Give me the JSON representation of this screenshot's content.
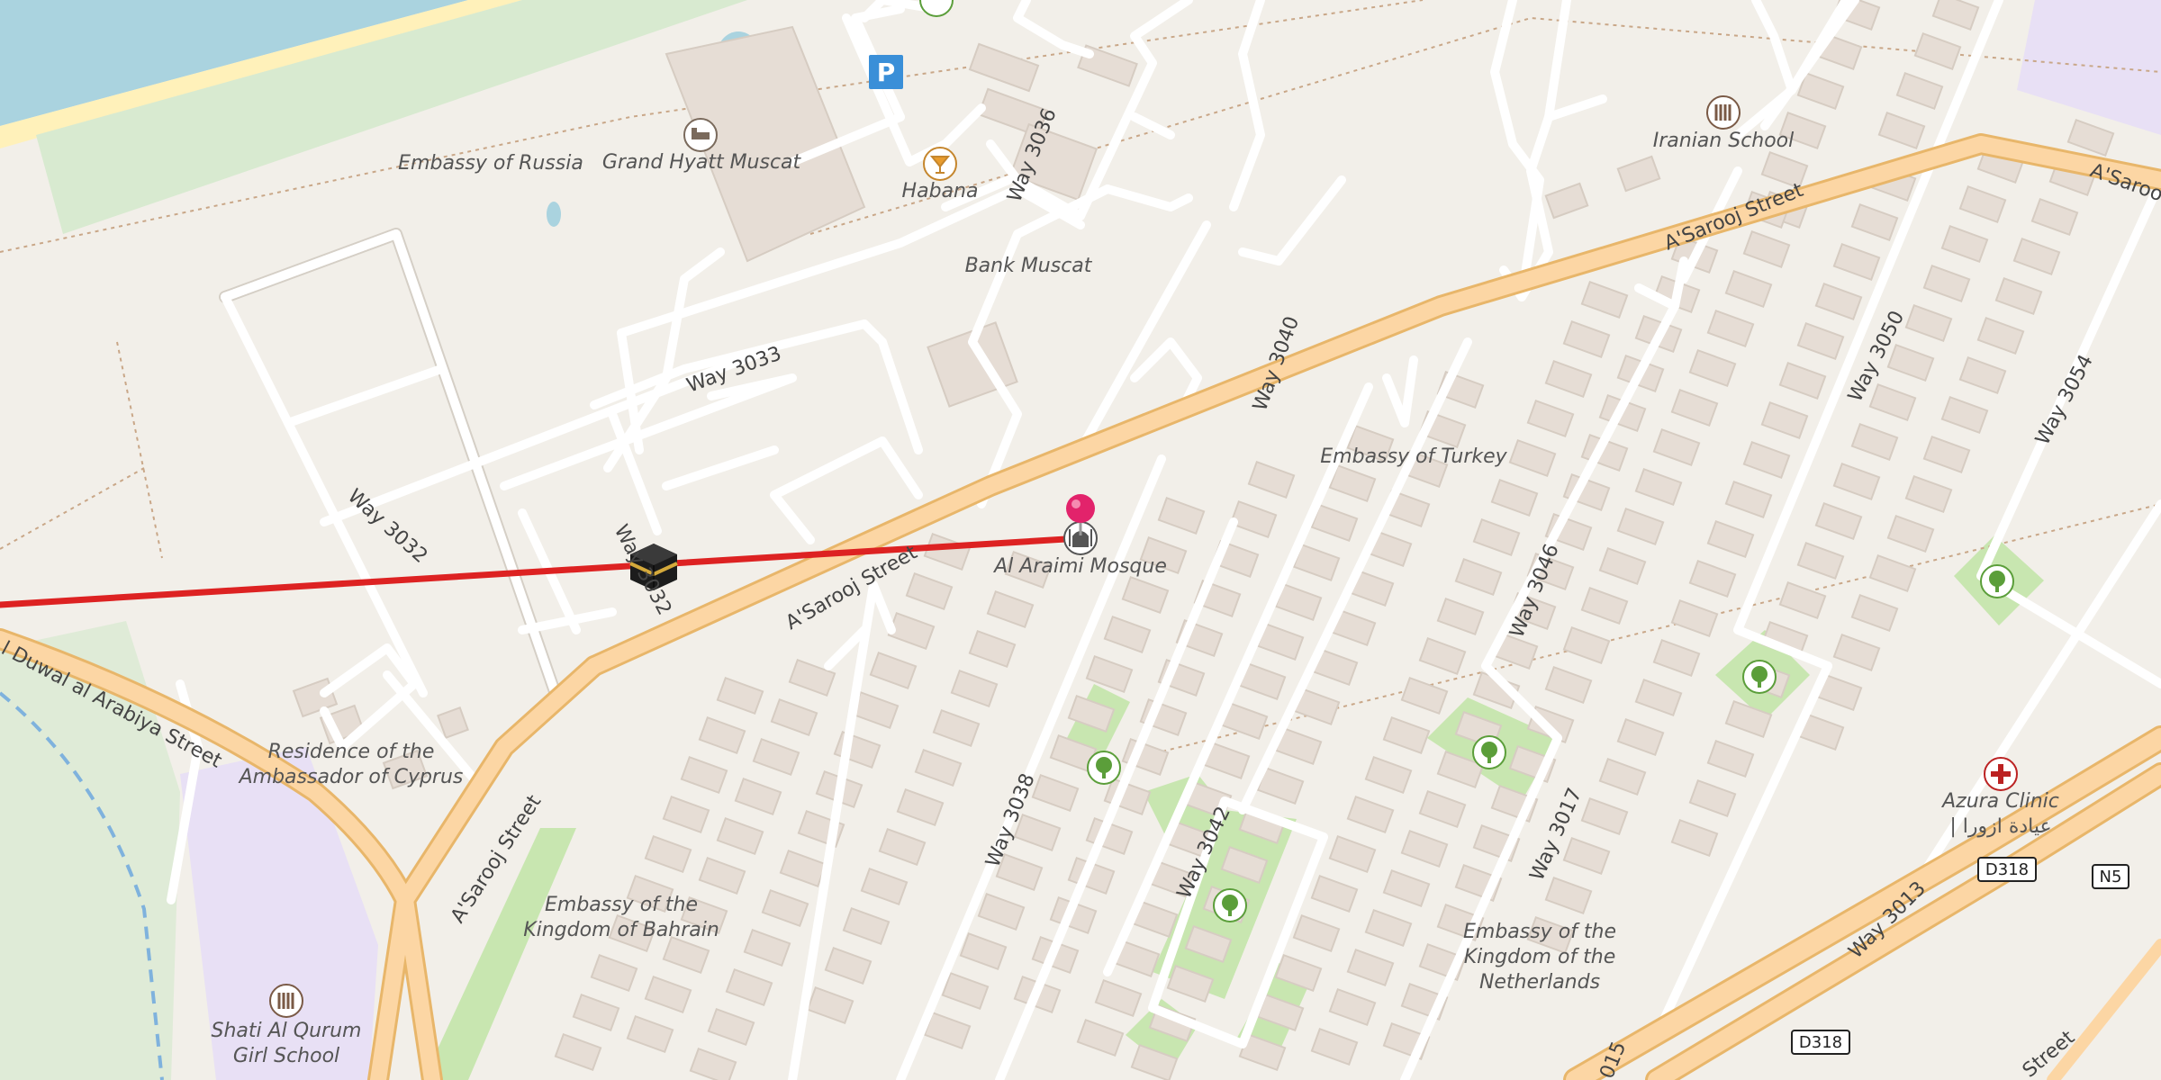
{
  "map": {
    "places": {
      "embassy_russia": "Embassy of Russia",
      "grand_hyatt": "Grand Hyatt Muscat",
      "habana": "Habana",
      "bank_muscat": "Bank Muscat",
      "iranian_school": "Iranian School",
      "embassy_turkey": "Embassy of Turkey",
      "al_araimi_mosque": "Al Araimi Mosque",
      "residence_cyprus_1": "Residence of the",
      "residence_cyprus_2": "Ambassador of Cyprus",
      "embassy_bahrain_1": "Embassy of the",
      "embassy_bahrain_2": "Kingdom of Bahrain",
      "shati_school_1": "Shati Al Qurum",
      "shati_school_2": "Girl School",
      "azura_clinic_1": "Azura Clinic",
      "azura_clinic_2": "| عيادة ازورا",
      "embassy_netherlands_1": "Embassy of the",
      "embassy_netherlands_2": "Kingdom of the",
      "embassy_netherlands_3": "Netherlands"
    },
    "roads": {
      "way_3036": "Way 3036",
      "way_3033": "Way 3033",
      "way_3040": "Way 3040",
      "way_3032_a": "Way 3032",
      "way_3032_b": "Way 3032",
      "asarooj_1": "A'Sarooj Street",
      "asarooj_2": "A'Sarooj Street",
      "asarooj_3": "A'Sarooj Street",
      "asarooj_4": "A'Saroo",
      "duwal": "l Duwal al Arabiya Street",
      "way_3038": "Way 3038",
      "way_3042": "Way 3042",
      "way_3046": "Way 3046",
      "way_3017": "Way 3017",
      "way_3050": "Way 3050",
      "way_3054": "Way 3054",
      "way_3013": "Way 3013",
      "way_015": "015",
      "street_br": "Street"
    },
    "shields": {
      "d318_a": "D318",
      "n5": "N5",
      "d318_b": "D318"
    },
    "parking": "P",
    "colors": {
      "background": "#f2efe9",
      "water": "#aad3df",
      "park": "#c8e6b0",
      "beach": "#fff1ba",
      "primary_road": "#fcd6a4",
      "primary_casing": "#e8b66a",
      "route_line": "#dd2222",
      "pin": "#e2236b",
      "institution": "#e8e0f5"
    },
    "icons": {
      "pin": "map-pin-icon",
      "kaaba": "kaaba-icon",
      "mosque": "mosque-icon",
      "hotel": "hotel-icon",
      "bar": "cocktail-icon",
      "school": "school-icon",
      "tree": "tree-icon",
      "clinic": "clinic-cross-icon",
      "parking": "parking-icon"
    }
  }
}
